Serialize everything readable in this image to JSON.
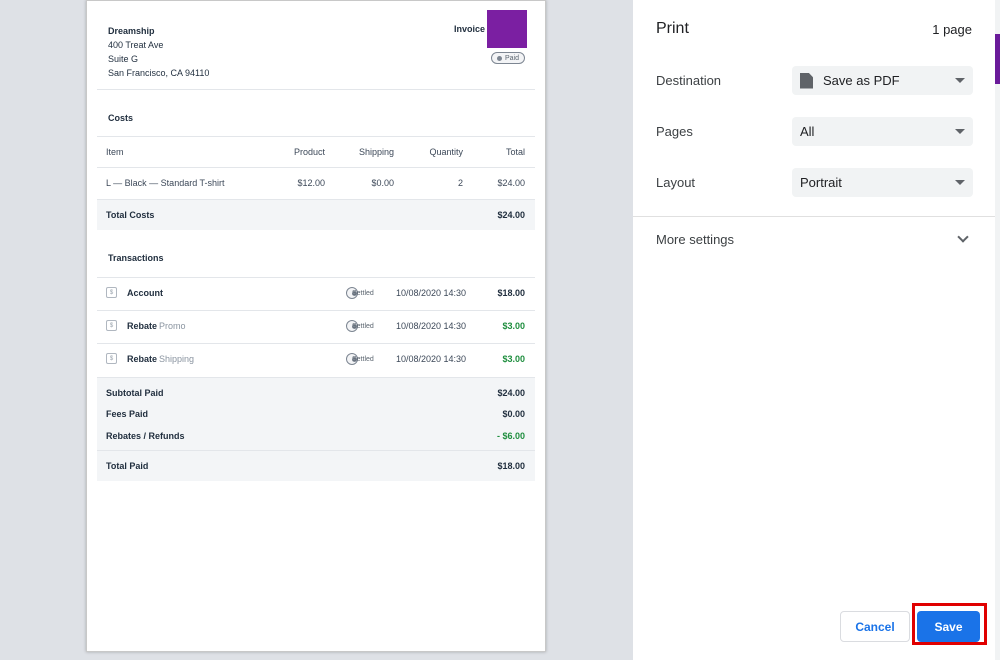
{
  "invoice": {
    "company_name": "Dreamship",
    "address_line1": "400 Treat Ave",
    "address_line2": "Suite G",
    "address_line3": "San Francisco, CA 94110",
    "title": "Invoice",
    "status": "Paid",
    "logo_color": "#7b1fa2"
  },
  "costs": {
    "title": "Costs",
    "headers": [
      "Item",
      "Product",
      "Shipping",
      "Quantity",
      "Total"
    ],
    "rows": [
      {
        "item": "L — Black — Standard T-shirt",
        "product": "$12.00",
        "shipping": "$0.00",
        "quantity": "2",
        "total": "$24.00"
      }
    ],
    "total_label": "Total Costs",
    "total_value": "$24.00"
  },
  "transactions": {
    "title": "Transactions",
    "rows": [
      {
        "name": "Account",
        "sub": "",
        "status": "Settled",
        "date": "10/08/2020 14:30",
        "amount": "$18.00"
      },
      {
        "name": "Rebate",
        "sub": "Promo",
        "status": "Settled",
        "date": "10/08/2020 14:30",
        "amount": "$3.00"
      },
      {
        "name": "Rebate",
        "sub": "Shipping",
        "status": "Settled",
        "date": "10/08/2020 14:30",
        "amount": "$3.00"
      }
    ],
    "summary": [
      {
        "label": "Subtotal Paid",
        "value": "$24.00"
      },
      {
        "label": "Fees Paid",
        "value": "$0.00"
      },
      {
        "label": "Rebates / Refunds",
        "value": "- $6.00"
      }
    ],
    "total_label": "Total Paid",
    "total_value": "$18.00"
  },
  "print": {
    "title": "Print",
    "page_count": "1 page",
    "destination_label": "Destination",
    "destination_value": "Save as PDF",
    "pages_label": "Pages",
    "pages_value": "All",
    "layout_label": "Layout",
    "layout_value": "Portrait",
    "more_settings": "More settings",
    "cancel": "Cancel",
    "save": "Save",
    "accent_color": "#1a73e8"
  }
}
